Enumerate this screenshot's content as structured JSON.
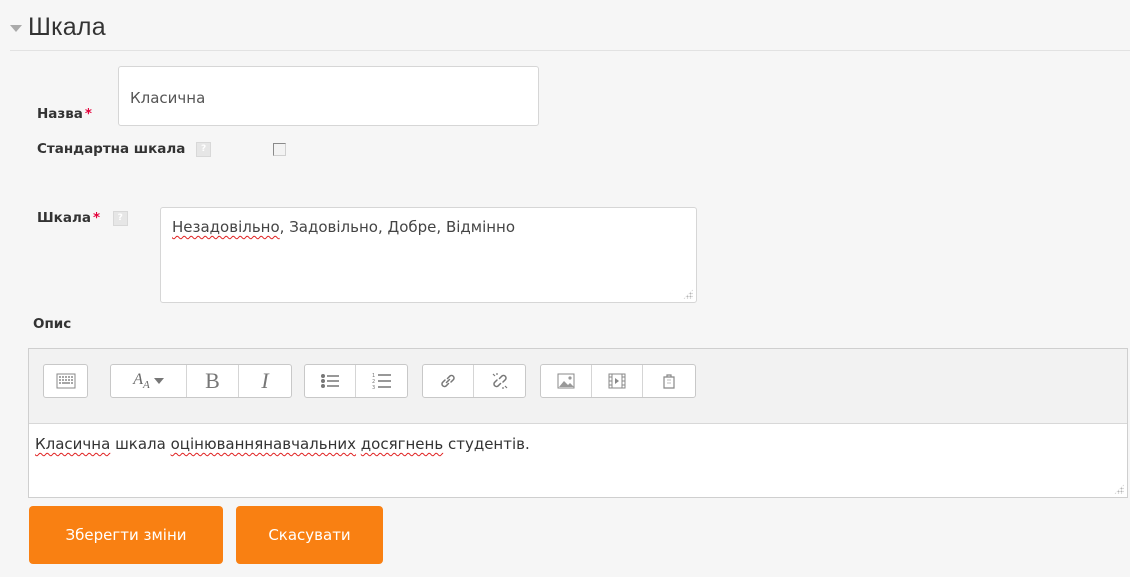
{
  "section": {
    "title": "Шкала"
  },
  "name_field": {
    "label": "Назва",
    "required_mark": "*",
    "value": "Класична"
  },
  "standard_scale": {
    "label": "Стандартна шкала",
    "help_glyph": "?",
    "checked": false
  },
  "scale_field": {
    "label": "Шкала",
    "required_mark": "*",
    "help_glyph": "?",
    "value_parts": [
      "Незадовільно",
      ", Задовільно, Добре, Відмінно"
    ]
  },
  "description": {
    "label": "Опис",
    "toolbar_icons": [
      "keyboard-toggle-icon",
      "font-size-icon",
      "bold-icon",
      "italic-icon",
      "unordered-list-icon",
      "ordered-list-icon",
      "link-icon",
      "unlink-icon",
      "image-icon",
      "media-icon",
      "manage-files-icon"
    ],
    "toolbar_text": {
      "font_glyph": "A",
      "font_sub": "A",
      "bold": "B",
      "italic": "I"
    },
    "content_parts": [
      "Класична",
      " шкала ",
      "оцінюваннянавчальних",
      " ",
      "досягнень",
      " студентів."
    ]
  },
  "actions": {
    "save_label": "Зберегти зміни",
    "cancel_label": "Скасувати"
  },
  "colors": {
    "accent": "#f98012",
    "required": "#e4003a"
  }
}
